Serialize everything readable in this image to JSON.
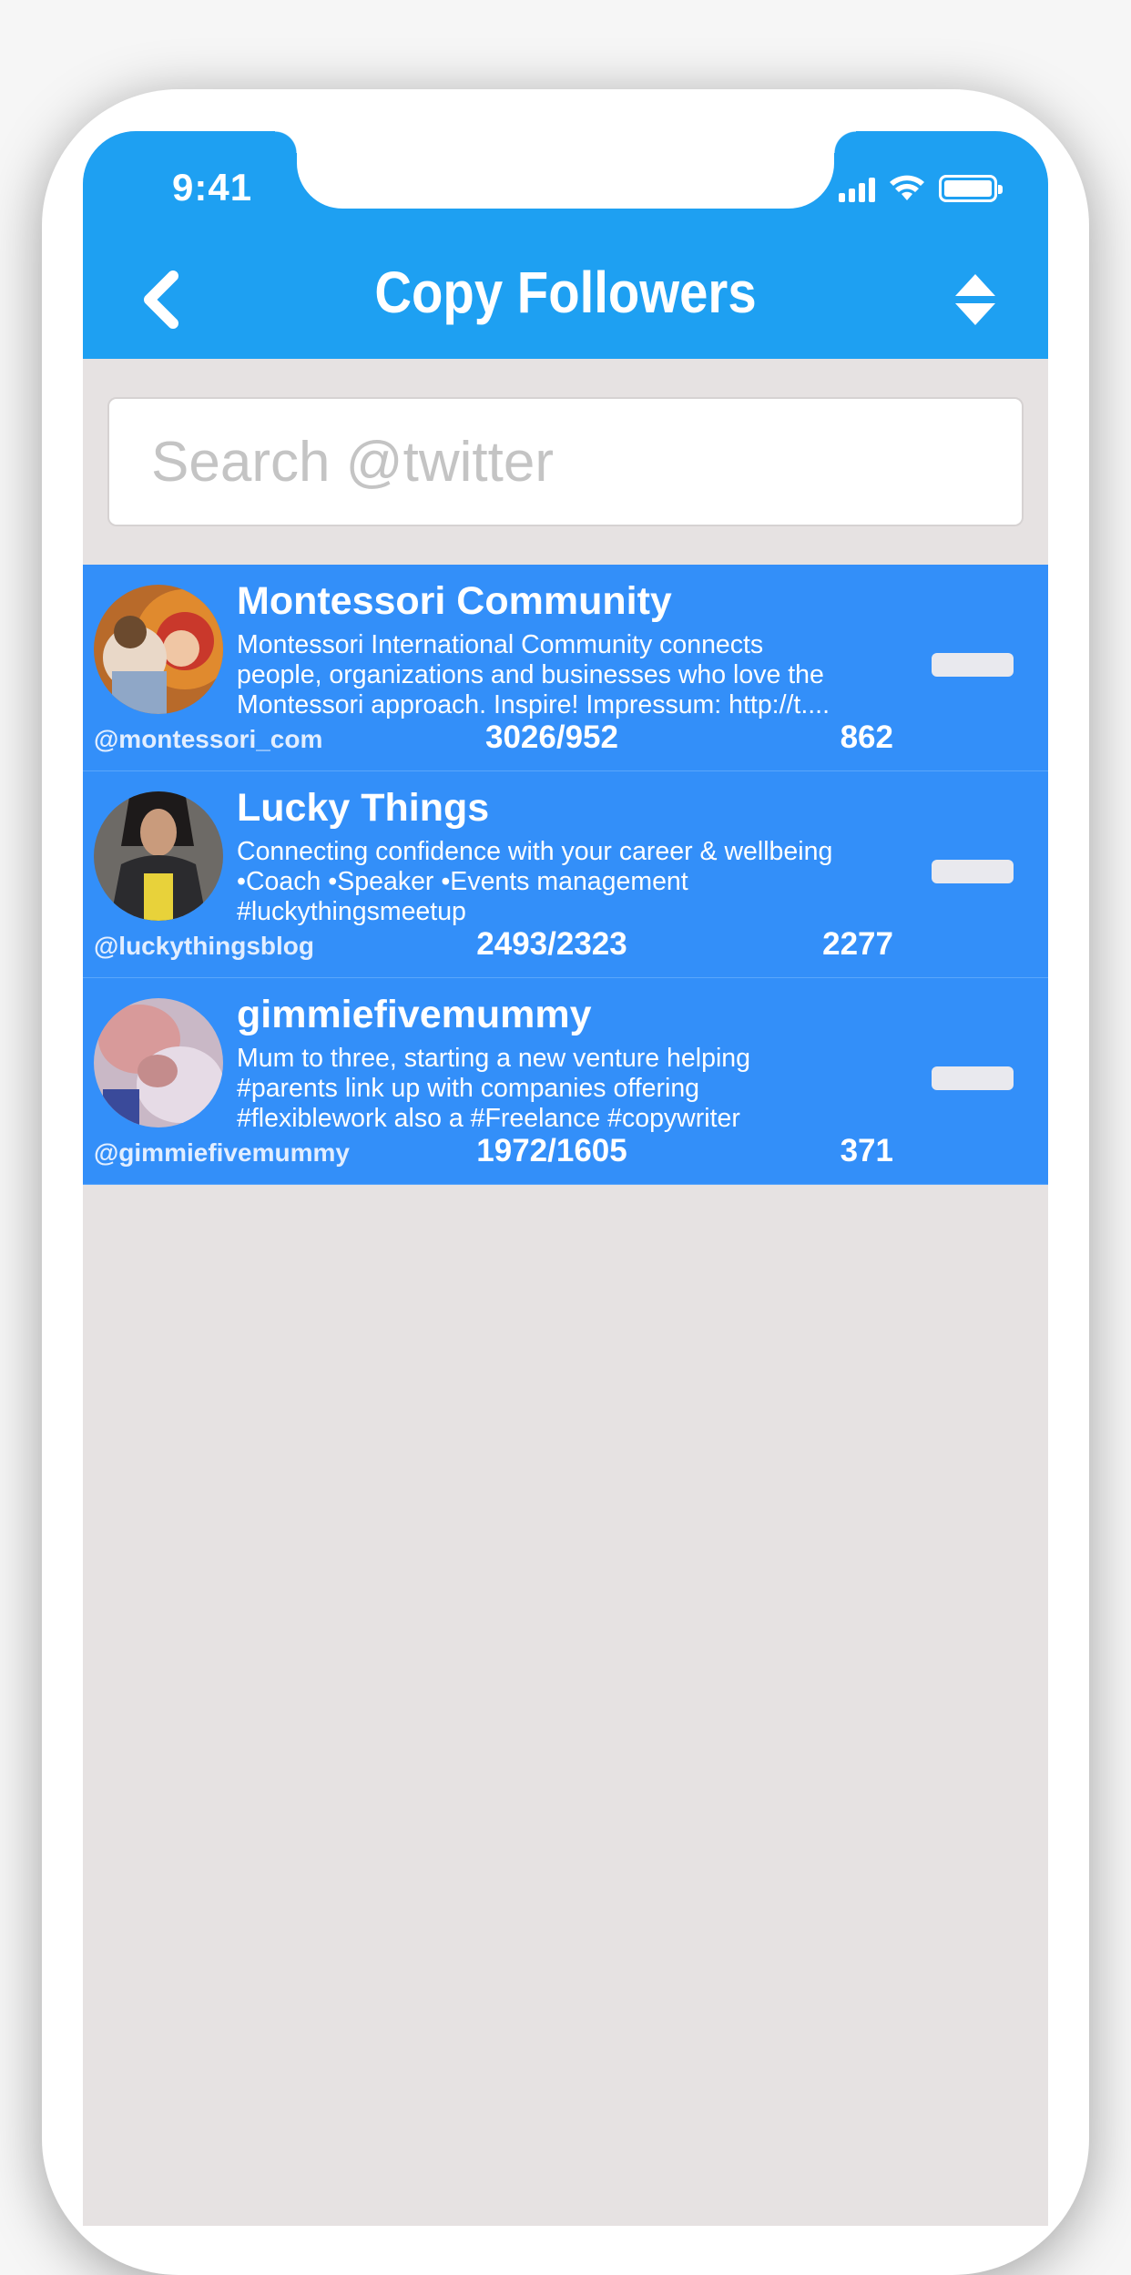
{
  "status_bar": {
    "time": "9:41"
  },
  "nav": {
    "title": "Copy Followers",
    "back_icon": "chevron-left-icon",
    "sort_icon": "sort-icon"
  },
  "search": {
    "placeholder": "Search @twitter",
    "value": ""
  },
  "colors": {
    "header": "#1ea0f2",
    "row": "#338ff9",
    "background": "#e6e2e2"
  },
  "accounts": [
    {
      "name": "Montessori Community",
      "bio": "Montessori International Community connects\npeople, organizations and businesses who love the\nMontessori approach. Inspire! Impressum: http://t....",
      "handle": "@montessori_com",
      "ratio": "3026/952",
      "count": "862"
    },
    {
      "name": "Lucky Things",
      "bio": "Connecting confidence with your career & wellbeing\n•Coach •Speaker •Events management\n#luckythingsmeetup",
      "handle": "@luckythingsblog",
      "ratio": "2493/2323",
      "count": "2277"
    },
    {
      "name": "gimmiefivemummy",
      "bio": "Mum to three, starting a new venture helping\n#parents link up with companies offering\n#flexiblework also a #Freelance #copywriter",
      "handle": "@gimmiefivemummy",
      "ratio": "1972/1605",
      "count": "371"
    }
  ]
}
